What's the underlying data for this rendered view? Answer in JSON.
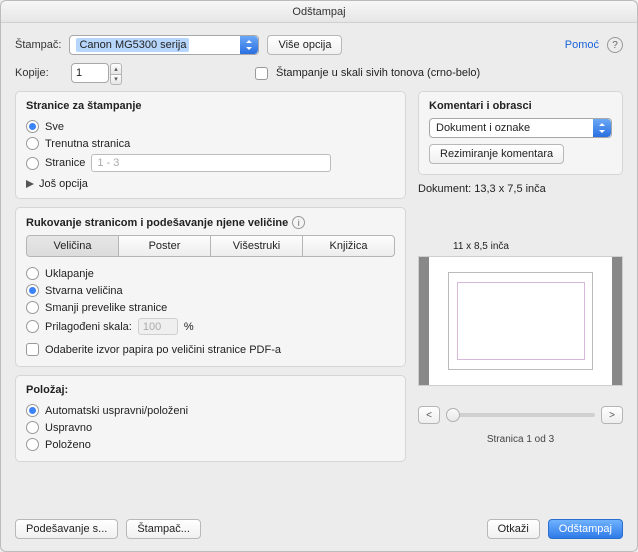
{
  "window": {
    "title": "Odštampaj"
  },
  "header": {
    "printer_label": "Štampač:",
    "printer_value": "Canon MG5300 serija",
    "more_options": "Više opcija",
    "help": "Pomoć",
    "copies_label": "Kopije:",
    "copies_value": "1",
    "grayscale_label": "Štampanje u skali sivih tonova (crno-belo)"
  },
  "pages_panel": {
    "title": "Stranice za štampanje",
    "all": "Sve",
    "current": "Trenutna stranica",
    "pages": "Stranice",
    "pages_placeholder": "1 - 3",
    "more": "Još opcija"
  },
  "handling_panel": {
    "title": "Rukovanje stranicom i podešavanje njene veličine",
    "tabs": {
      "size": "Veličina",
      "poster": "Poster",
      "multiple": "Višestruki",
      "booklet": "Knjižica"
    },
    "fit": "Uklapanje",
    "actual": "Stvarna veličina",
    "shrink": "Smanji prevelike stranice",
    "custom": "Prilagođeni skala:",
    "custom_value": "100",
    "custom_unit": "%",
    "paper_source": "Odaberite izvor papira po veličini stranice PDF-a"
  },
  "orientation_panel": {
    "title": "Položaj:",
    "auto": "Automatski uspravni/položeni",
    "portrait": "Uspravno",
    "landscape": "Položeno"
  },
  "comments_panel": {
    "title": "Komentari i obrasci",
    "select_value": "Dokument i oznake",
    "summarize": "Rezimiranje komentara"
  },
  "preview": {
    "doc_size": "Dokument: 13,3 x 7,5 inča",
    "paper_size": "11 x 8,5 inča",
    "page_indicator": "Stranica 1 od 3"
  },
  "footer": {
    "page_setup": "Podešavanje s...",
    "printer": "Štampač...",
    "cancel": "Otkaži",
    "print": "Odštampaj"
  }
}
